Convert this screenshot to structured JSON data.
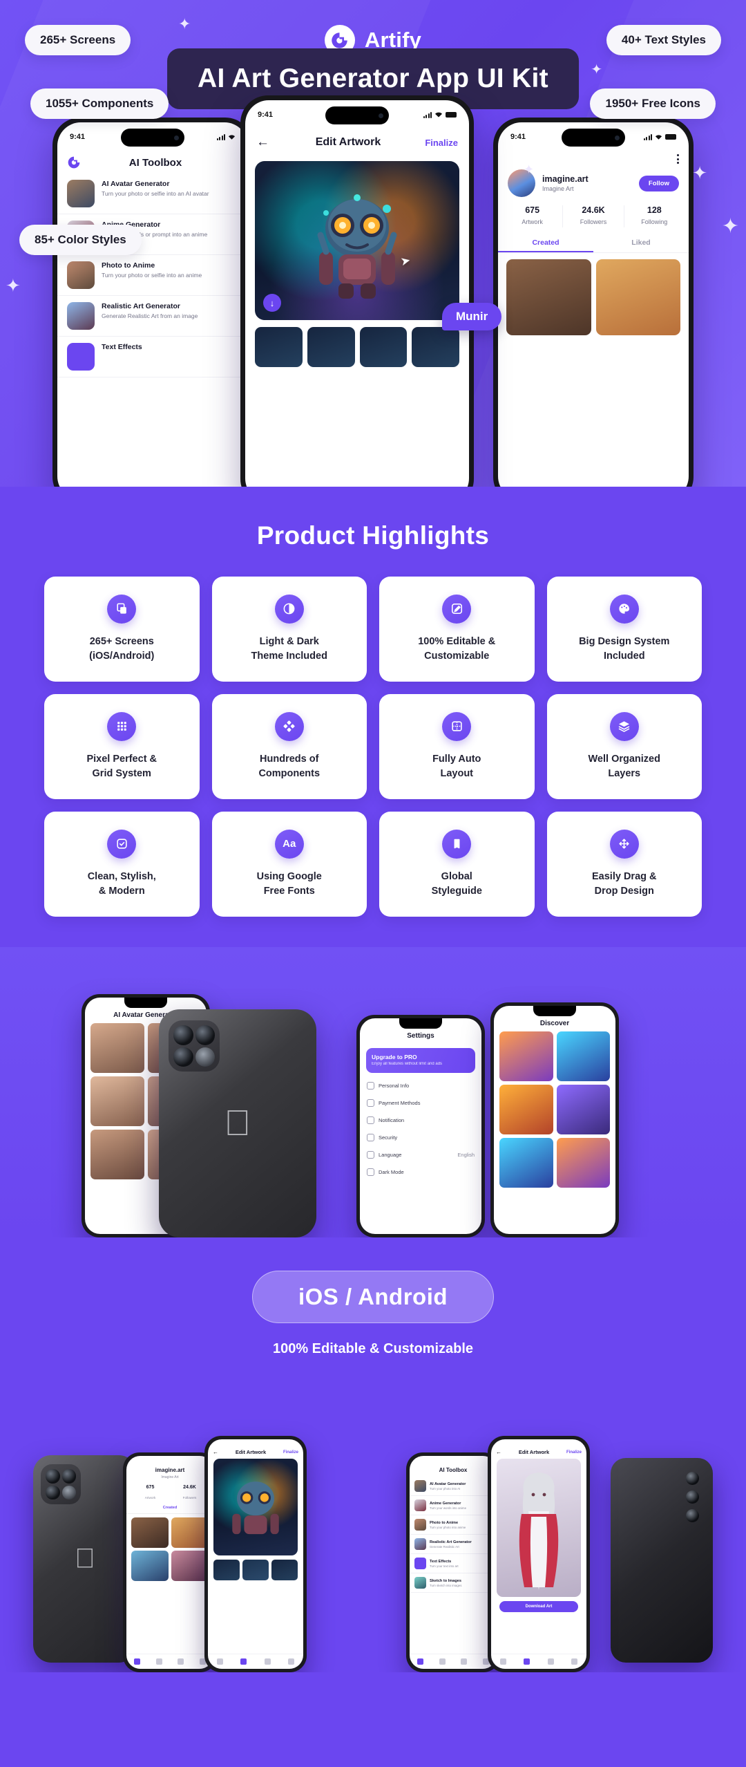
{
  "brand": {
    "name": "Artify",
    "logo_icon": "artify-logo-icon",
    "accent": "#6B46F0",
    "dark": "#2E2550"
  },
  "hero": {
    "title": "AI Art Generator App UI Kit",
    "pills": [
      {
        "label": "265+ Screens"
      },
      {
        "label": "40+ Text Styles"
      },
      {
        "label": "1055+ Components"
      },
      {
        "label": "1950+ Free Icons"
      },
      {
        "label": "85+ Color Styles"
      }
    ],
    "cursor_label": "Munir"
  },
  "phone_left": {
    "status_time": "9:41",
    "title": "AI Toolbox",
    "tools": [
      {
        "title": "AI Avatar Generator",
        "desc": "Turn your photo or selfie into an AI avatar"
      },
      {
        "title": "Anime Generator",
        "desc": "Turn your words or prompt into an anime"
      },
      {
        "title": "Photo to Anime",
        "desc": "Turn your photo or selfie into an anime"
      },
      {
        "title": "Realistic Art Generator",
        "desc": "Generate Realistic Art from an image"
      },
      {
        "title": "Text Effects",
        "desc": ""
      }
    ]
  },
  "phone_center": {
    "status_time": "9:41",
    "back_icon": "arrow-left-icon",
    "title": "Edit Artwork",
    "action": "Finalize",
    "download_icon": "download-icon"
  },
  "phone_right": {
    "status_time": "9:41",
    "menu_icon": "more-vertical-icon",
    "username": "imagine.art",
    "display_name": "Imagine Art",
    "follow_label": "Follow",
    "stats": [
      {
        "value": "675",
        "label": "Artwork"
      },
      {
        "value": "24.6K",
        "label": "Followers"
      },
      {
        "value": "128",
        "label": "Following"
      }
    ],
    "tabs": [
      {
        "label": "Created",
        "active": true
      },
      {
        "label": "Liked",
        "active": false
      }
    ]
  },
  "highlights": {
    "title": "Product Highlights",
    "cards": [
      {
        "icon": "copy-screens-icon",
        "label": "265+ Screens\n(iOS/Android)"
      },
      {
        "icon": "contrast-icon",
        "label": "Light & Dark\nTheme Included"
      },
      {
        "icon": "edit-pencil-icon",
        "label": "100% Editable &\nCustomizable"
      },
      {
        "icon": "palette-icon",
        "label": "Big Design System\nIncluded"
      },
      {
        "icon": "grid-icon",
        "label": "Pixel Perfect &\nGrid System"
      },
      {
        "icon": "components-icon",
        "label": "Hundreds of\nComponents"
      },
      {
        "icon": "auto-layout-icon",
        "label": "Fully Auto\nLayout"
      },
      {
        "icon": "layers-icon",
        "label": "Well Organized\nLayers"
      },
      {
        "icon": "check-square-icon",
        "label": "Clean, Stylish,\n& Modern"
      },
      {
        "icon": "font-aa-icon",
        "label": "Using Google\nFree Fonts"
      },
      {
        "icon": "styleguide-icon",
        "label": "Global\nStyleguide"
      },
      {
        "icon": "drag-move-icon",
        "label": "Easily Drag &\nDrop Design"
      }
    ]
  },
  "showcase": {
    "screens": [
      {
        "title": "AI Avatar Generator"
      },
      {
        "title": "Settings"
      },
      {
        "title": "Discover"
      }
    ],
    "settings_items": [
      {
        "label": "Personal Info"
      },
      {
        "label": "Payment Methods"
      },
      {
        "label": "Notification"
      },
      {
        "label": "Security"
      },
      {
        "label": "Language"
      },
      {
        "label": "Dark Mode"
      }
    ],
    "settings_language_value": "English",
    "pro_card": {
      "title": "Upgrade to PRO",
      "desc": "Enjoy all features without limit and ads"
    },
    "search_icon": "search-icon"
  },
  "platform": {
    "badge": "iOS / Android",
    "subtitle": "100% Editable & Customizable"
  },
  "bottom": {
    "left_screens": [
      {
        "title": "imagine.art",
        "sub": "Imagine Art"
      },
      {
        "title": "Edit Artwork",
        "action": "Finalize"
      }
    ],
    "left_stats": [
      {
        "value": "675",
        "label": "Artwork"
      },
      {
        "value": "24.6K",
        "label": "Followers"
      }
    ],
    "left_tab": "Created",
    "right_screens": [
      {
        "title": "AI Toolbox"
      },
      {
        "title": "Edit Artwork",
        "action": "Finalize"
      }
    ],
    "right_tools": [
      {
        "title": "AI Avatar Generator",
        "desc": "Turn your photo into AI"
      },
      {
        "title": "Anime Generator",
        "desc": "Turn your words into anime"
      },
      {
        "title": "Photo to Anime",
        "desc": "Turn your photo into anime"
      },
      {
        "title": "Realistic Art Generator",
        "desc": "Generate Realistic Art"
      },
      {
        "title": "Text Effects",
        "desc": "Turn your text into art"
      },
      {
        "title": "Sketch to Images",
        "desc": "Turn sketch into images"
      }
    ],
    "right_button": "Download Art"
  }
}
